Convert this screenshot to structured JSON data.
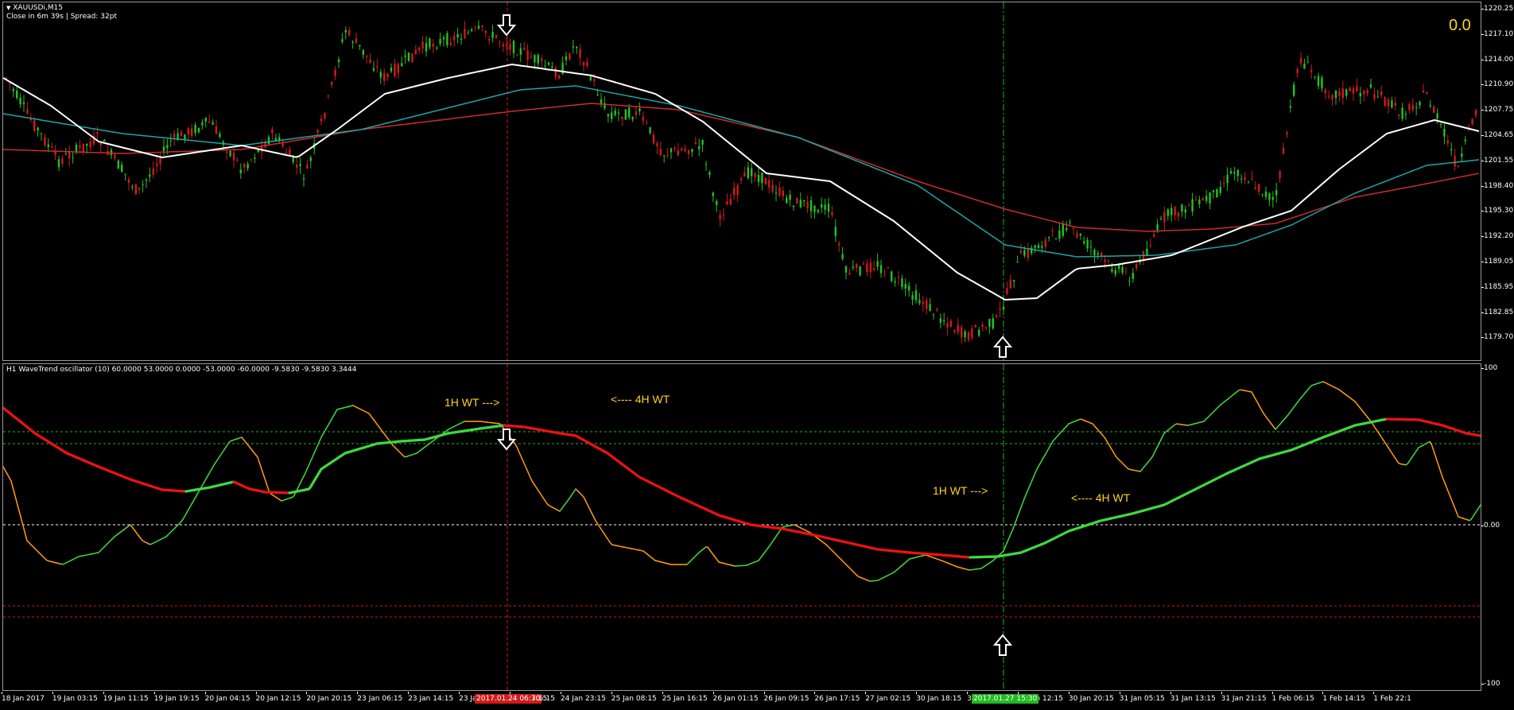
{
  "chart_header": {
    "symbol": "XAUUSDi,M15",
    "status": "Close in 6m 39s | Spread: 32pt",
    "counter": "0.0"
  },
  "main_scale": [
    "1220.25",
    "1217.10",
    "1214.00",
    "1210.90",
    "1207.75",
    "1204.65",
    "1201.55",
    "1198.40",
    "1195.30",
    "1192.20",
    "1189.05",
    "1185.95",
    "1182.85",
    "1179.70"
  ],
  "oscillator": {
    "title": "H1 WaveTrend oscillator (10) 60.0000 53.0000 0.0000 -53.0000 -60.0000 -9.5830 -9.5830 3.3444",
    "scale_top": "100",
    "scale_mid": "0.00",
    "scale_bottom": "-100",
    "levels": [
      60,
      53,
      0,
      -53,
      -60
    ],
    "annotations": {
      "wt1h_top": "1H WT --->",
      "wt4h_top": "<---- 4H WT",
      "wt1h_bottom": "1H WT --->",
      "wt4h_bottom": "<---- 4H WT"
    }
  },
  "time_axis": [
    "18 Jan 2017",
    "19 Jan 03:15",
    "19 Jan 11:15",
    "19 Jan 19:15",
    "20 Jan 04:15",
    "20 Jan 12:15",
    "20 Jan 20:15",
    "23 Jan 06:15",
    "23 Jan 14:15",
    "23 Jan",
    "24 Jan 15:15",
    "24 Jan 23:15",
    "25 Jan 08:15",
    "25 Jan 16:15",
    "26 Jan 01:15",
    "26 Jan 09:15",
    "26 Jan 17:15",
    "27 Jan 02:15",
    "30 Jan 18:15",
    "30 Jan 04:15",
    "30 Jan 12:15",
    "30 Jan 20:15",
    "31 Jan 05:15",
    "31 Jan 13:15",
    "31 Jan 21:15",
    "1 Feb 06:15",
    "1 Feb 14:15",
    "1 Feb 22:1"
  ],
  "cursor_labels": {
    "sell": "2017.01.24 06:30",
    "sell_tail": "7:15",
    "buy": "2017.01.27 15:30"
  },
  "colors": {
    "bull_candle": "#22c322",
    "bear_candle": "#d11a1a",
    "ma_fast": "#ffffff",
    "ma_mid": "#1aa6a6",
    "ma_slow": "#d12a2a",
    "wt_rising": "#3fd83f",
    "wt_falling": "#ff9a10",
    "wt4h_falling": "#ee1111",
    "level_pos": "#1fb81f",
    "level_neg": "#e01010",
    "annotation": "#ffd21f"
  },
  "signals": [
    {
      "type": "sell-arrow",
      "label": "down"
    },
    {
      "type": "buy-arrow",
      "label": "up"
    }
  ]
}
